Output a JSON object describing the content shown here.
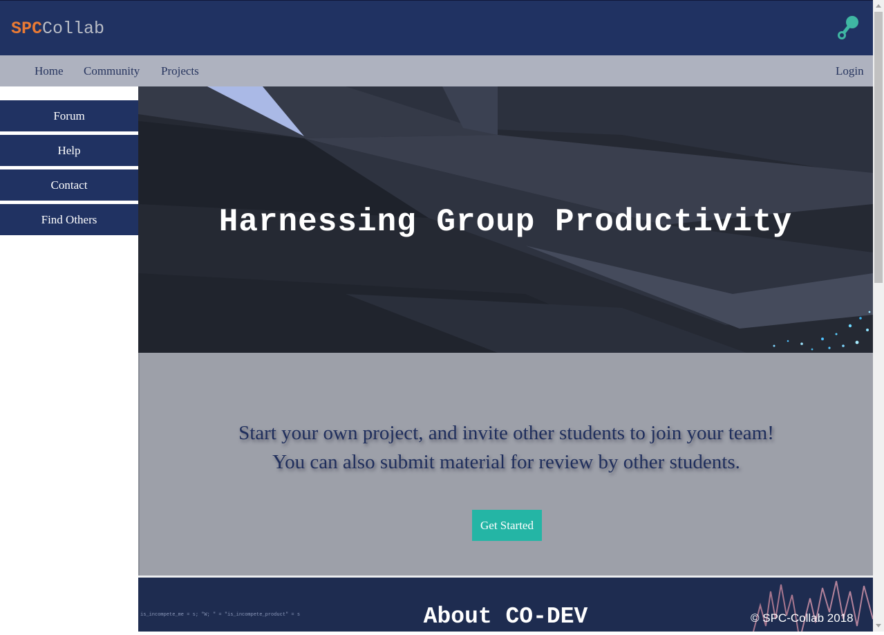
{
  "header": {
    "logo_spc": "SPC",
    "logo_collab": "Collab",
    "brand_icon": "molecule-icon",
    "accent_color": "#e97a34",
    "bar_color": "#203262"
  },
  "nav": {
    "home": "Home",
    "community": "Community",
    "projects": "Projects",
    "login": "Login"
  },
  "sidebar": {
    "items": [
      {
        "label": "Forum"
      },
      {
        "label": "Help"
      },
      {
        "label": "Contact"
      },
      {
        "label": "Find Others"
      }
    ]
  },
  "hero": {
    "title": "Harnessing Group Productivity"
  },
  "cta": {
    "line1": "Start your own project, and invite other students to join your team!",
    "line2": "You can also submit material for review by other students.",
    "button": "Get Started",
    "button_color": "#24b5a5"
  },
  "about": {
    "title": "About CO-DEV",
    "code_hint": "is_incompete_me = s; \"W; \" = \"is_incompete_product\" = s"
  },
  "footer": {
    "copyright": "© SPC-Collab 2018"
  }
}
